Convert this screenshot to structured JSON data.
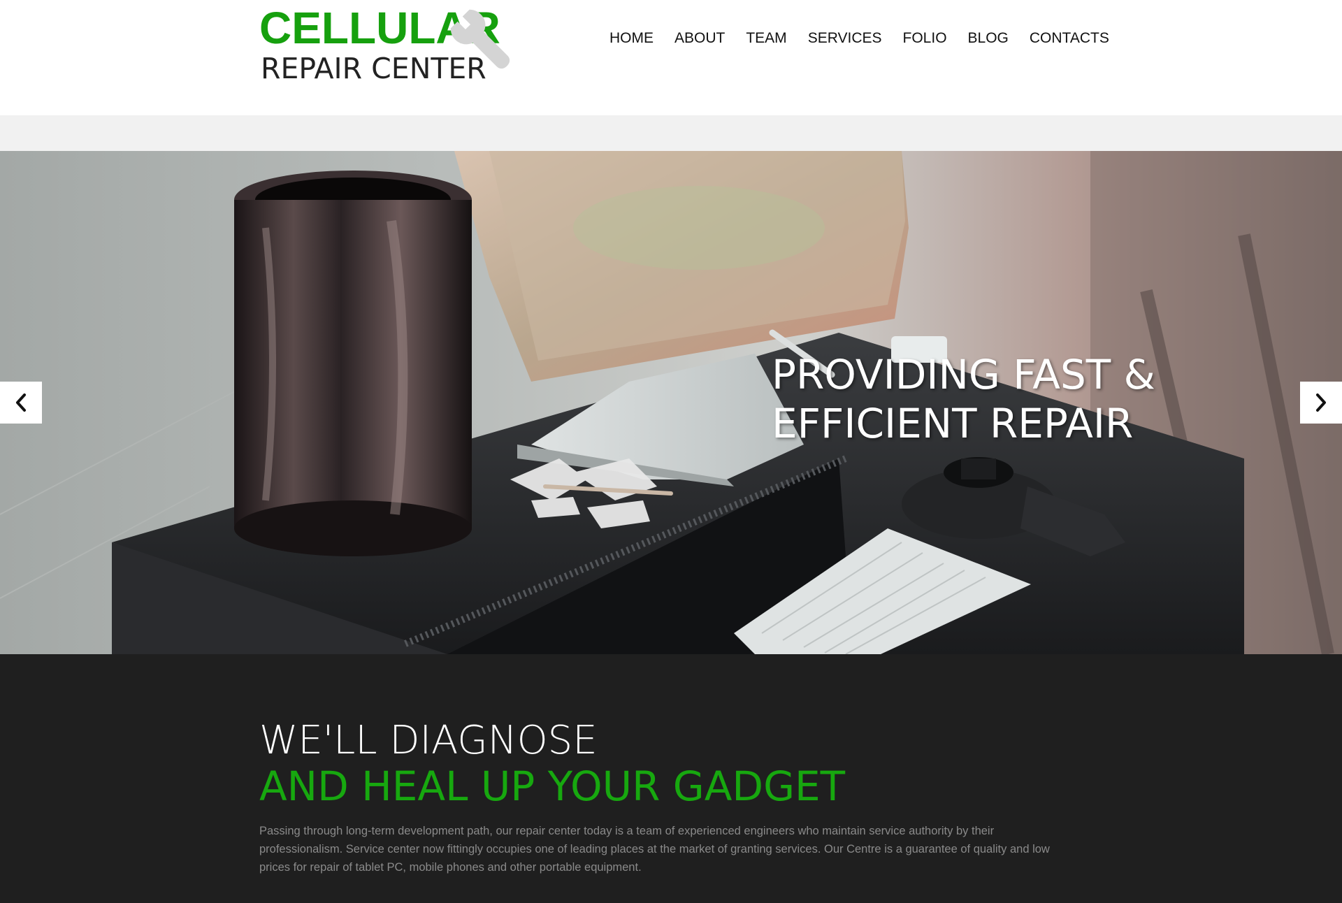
{
  "brand": {
    "name_primary": "CELLULAR",
    "name_secondary": "REPAIR CENTER",
    "accent_color": "#16a00e"
  },
  "nav": {
    "items": [
      {
        "label": "HOME"
      },
      {
        "label": "ABOUT"
      },
      {
        "label": "TEAM"
      },
      {
        "label": "SERVICES"
      },
      {
        "label": "FOLIO"
      },
      {
        "label": "BLOG"
      },
      {
        "label": "CONTACTS"
      }
    ]
  },
  "hero": {
    "caption_line1": "PROVIDING FAST &",
    "caption_line2": "EFFICIENT REPAIR",
    "prev_icon": "chevron-left-icon",
    "next_icon": "chevron-right-icon"
  },
  "intro": {
    "heading_line1": "WE'LL DIAGNOSE",
    "heading_line2": "AND HEAL UP YOUR GADGET",
    "body": "Passing through long-term development path, our repair center today is a team of experienced engineers who maintain service authority by their professionalism. Service center now fittingly occupies one of leading places at the market of granting services.  Our Centre is a guarantee of quality and low prices for repair of tablet PC, mobile phones and other portable equipment."
  }
}
